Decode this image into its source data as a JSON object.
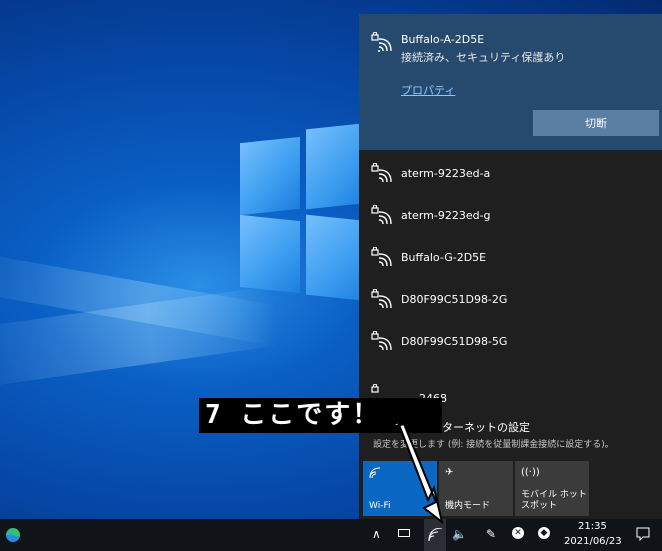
{
  "connected_network": {
    "name": "Buffalo-A-2D5E",
    "status": "接続済み、セキュリティ保護あり",
    "properties_link": "プロパティ",
    "disconnect_label": "切断"
  },
  "networks": [
    {
      "name": "aterm-9223ed-a"
    },
    {
      "name": "aterm-9223ed-g"
    },
    {
      "name": "Buffalo-G-2D5E"
    },
    {
      "name": "D80F99C51D98-2G"
    },
    {
      "name": "D80F99C51D98-5G"
    },
    {
      "name": "2468"
    }
  ],
  "network_settings": {
    "title": "ンターネットの設定",
    "subtitle": "設定を変更します (例: 接続を従量制課金接続に設定する)。"
  },
  "quick_actions": [
    {
      "label": "Wi-Fi",
      "icon": "wifi-icon",
      "state": "on"
    },
    {
      "label": "機内モード",
      "icon": "airplane-icon",
      "state": "off"
    },
    {
      "label": "モバイル ホットスポット",
      "icon": "hotspot-icon",
      "state": "off"
    }
  ],
  "taskbar": {
    "time": "21:35",
    "date": "2021/06/23",
    "tray_icons": [
      "chevron-up-icon",
      "battery-icon",
      "wifi-icon",
      "volume-icon",
      "pen-icon",
      "x-circle-icon",
      "dropbox-icon",
      "notification-icon"
    ]
  },
  "callout": {
    "text": "7 ここです！"
  },
  "colors": {
    "flyout_bg": "#1f1f1f",
    "connected_bg": "#264a6e",
    "accent": "#0a67c2",
    "link": "#8fc5ff"
  }
}
